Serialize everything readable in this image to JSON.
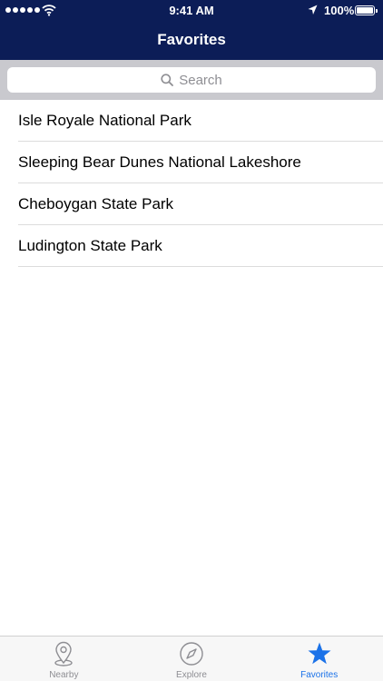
{
  "status_bar": {
    "time": "9:41 AM",
    "battery": "100%",
    "signal_icon": "signal-dots-icon",
    "wifi_icon": "wifi-icon",
    "location_icon": "location-arrow-icon",
    "battery_icon": "battery-icon"
  },
  "navbar": {
    "title": "Favorites"
  },
  "search": {
    "placeholder": "Search",
    "icon": "search-icon"
  },
  "favorites": [
    "Isle Royale National Park",
    "Sleeping Bear Dunes National Lakeshore",
    "Cheboygan State Park",
    "Ludington State Park"
  ],
  "tabs": [
    {
      "label": "Nearby",
      "icon": "map-pin-icon",
      "active": false
    },
    {
      "label": "Explore",
      "icon": "compass-icon",
      "active": false
    },
    {
      "label": "Favorites",
      "icon": "star-icon",
      "active": true
    }
  ],
  "colors": {
    "navbar": "#0c1d57",
    "search_bar_bg": "#c9c9ce",
    "active_tab": "#1b72e8",
    "inactive_tab": "#8e8e93"
  }
}
